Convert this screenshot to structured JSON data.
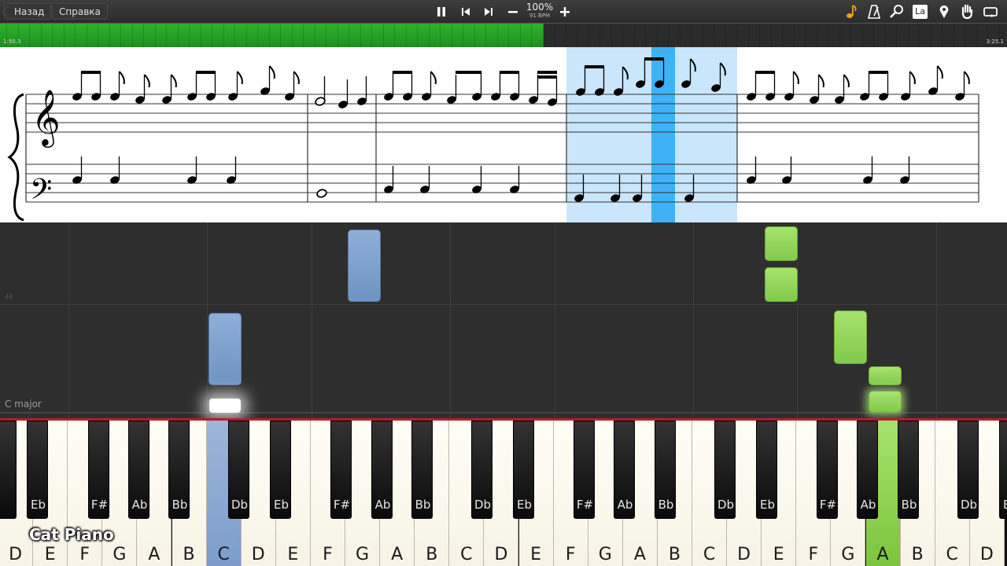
{
  "toolbar": {
    "back_label": "Назад",
    "help_label": "Справка",
    "tempo_percent": "100%",
    "tempo_bpm": "91 BPM",
    "right_icons": [
      "note-icon",
      "metronome-icon",
      "magnifier-icon",
      "language-icon",
      "location-pin-icon",
      "hand-icon",
      "loop-icon"
    ],
    "lang_badge": "La"
  },
  "progress": {
    "current_time": "1:50.3",
    "total_time": "3:25.1",
    "fraction": 0.54
  },
  "waterfall": {
    "key_signature": "C major",
    "measure_number": "44"
  },
  "keyboard": {
    "white_keys": [
      "D",
      "E",
      "F",
      "G",
      "A",
      "B",
      "C",
      "D",
      "E",
      "F",
      "G",
      "A",
      "B",
      "C",
      "D",
      "E",
      "F",
      "G",
      "A",
      "B",
      "C",
      "D",
      "E",
      "F",
      "G",
      "A",
      "B",
      "C",
      "D"
    ],
    "black_keys": [
      "Eb",
      "F#",
      "Ab",
      "Bb",
      "Db",
      "Eb",
      "F#",
      "Ab",
      "Bb",
      "Db",
      "Eb",
      "F#",
      "Ab",
      "Bb",
      "Db",
      "Eb",
      "F#",
      "Ab",
      "Bb",
      "Db",
      "Eb"
    ],
    "pressed": [
      {
        "key": "C",
        "hand": "left",
        "color": "#7b9ccb"
      },
      {
        "key": "A",
        "hand": "right",
        "color": "#7cc43e"
      }
    ]
  },
  "brand": "Cat Piano"
}
